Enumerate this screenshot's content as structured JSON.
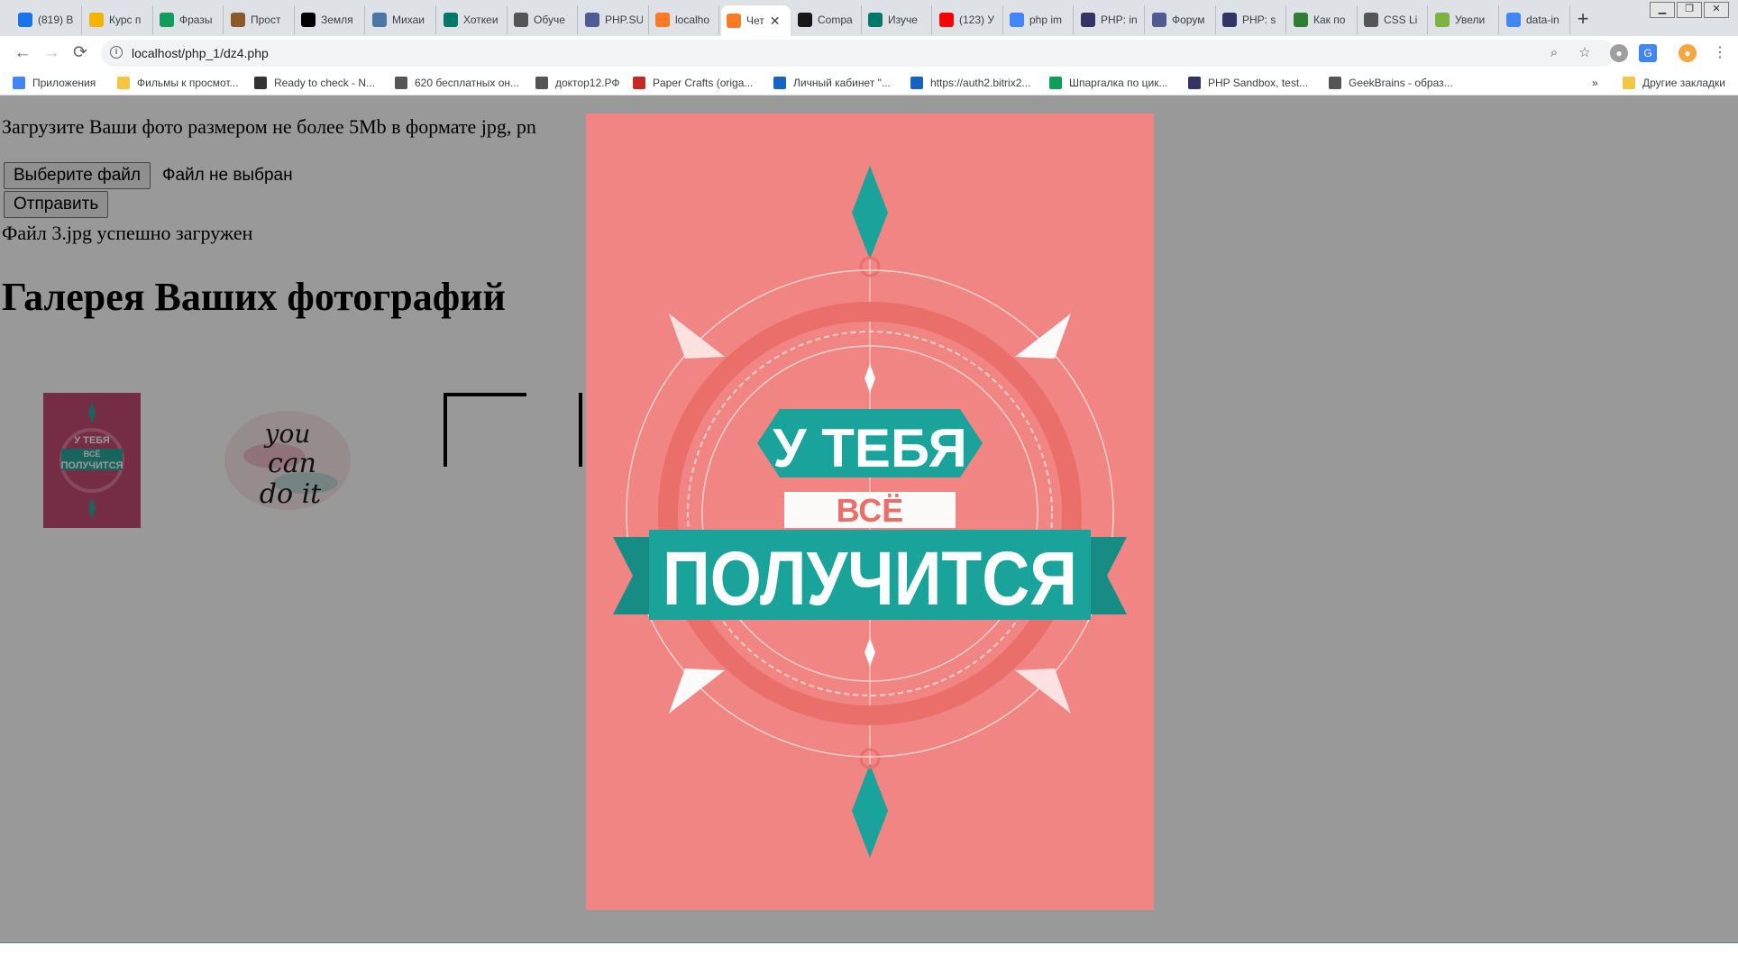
{
  "browser": {
    "tabs": [
      {
        "title": "(819) В",
        "icon": "mail-icon",
        "color": "#1a73e8"
      },
      {
        "title": "Курс п",
        "icon": "puzzle-icon",
        "color": "#f4b400"
      },
      {
        "title": "Фразы",
        "icon": "ed-icon",
        "color": "#0f9d58"
      },
      {
        "title": "Прост",
        "icon": "s-icon",
        "color": "#8b5a2b"
      },
      {
        "title": "Земля",
        "icon": "3g-icon",
        "color": "#000000"
      },
      {
        "title": "Михаи",
        "icon": "vk-icon",
        "color": "#4a76a8"
      },
      {
        "title": "Хоткеи",
        "icon": "circle-icon",
        "color": "#00796b"
      },
      {
        "title": "Обуче",
        "icon": "gear-icon",
        "color": "#555555"
      },
      {
        "title": "PHP.SU",
        "icon": "php-icon",
        "color": "#4f5b93"
      },
      {
        "title": "localho",
        "icon": "xampp-icon",
        "color": "#fb7a24"
      },
      {
        "title": "Чет",
        "icon": "xampp-icon",
        "color": "#fb7a24",
        "active": true
      },
      {
        "title": "Compa",
        "icon": "github-icon",
        "color": "#181717"
      },
      {
        "title": "Изуче",
        "icon": "circle-icon",
        "color": "#00796b"
      },
      {
        "title": "(123) У",
        "icon": "youtube-icon",
        "color": "#ff0000"
      },
      {
        "title": "php im",
        "icon": "google-icon",
        "color": "#4285f4"
      },
      {
        "title": "PHP: in",
        "icon": "php-doc-icon",
        "color": "#333366"
      },
      {
        "title": "Форум",
        "icon": "php-icon",
        "color": "#4f5b93"
      },
      {
        "title": "PHP: s",
        "icon": "php-doc-icon",
        "color": "#333366"
      },
      {
        "title": "Как по",
        "icon": "leaf-icon",
        "color": "#2e7d32"
      },
      {
        "title": "CSS Li",
        "icon": "globe-icon",
        "color": "#555555"
      },
      {
        "title": "Увели",
        "icon": "gear-green-icon",
        "color": "#7cb342"
      },
      {
        "title": "data-in",
        "icon": "google-icon",
        "color": "#4285f4"
      }
    ],
    "close_glyph": "✕",
    "new_tab_glyph": "+",
    "url": "localhost/php_1/dz4.php",
    "bookmarks": [
      {
        "label": "Приложения",
        "icon": "apps-icon",
        "color": "#4285f4"
      },
      {
        "label": "Фильмы к просмот...",
        "icon": "folder-icon",
        "color": "#f4c542"
      },
      {
        "label": "Ready to check - N...",
        "icon": "butterfly-icon",
        "color": "#333333"
      },
      {
        "label": "620 бесплатных он...",
        "icon": "globe-icon",
        "color": "#555555"
      },
      {
        "label": "доктор12.РФ",
        "icon": "doc-icon",
        "color": "#555555"
      },
      {
        "label": "Paper Crafts (origa...",
        "icon": "paper-icon",
        "color": "#c62828"
      },
      {
        "label": "Личный кабинет \"...",
        "icon": "pin-icon",
        "color": "#1565c0"
      },
      {
        "label": "https://auth2.bitrix2...",
        "icon": "bitrix-icon",
        "color": "#1565c0"
      },
      {
        "label": "Шпаргалка по цик...",
        "icon": "sheets-icon",
        "color": "#0f9d58"
      },
      {
        "label": "PHP Sandbox, test...",
        "icon": "sandbox-icon",
        "color": "#333366"
      },
      {
        "label": "GeekBrains - образ...",
        "icon": "gear-icon",
        "color": "#555555"
      }
    ],
    "bookmarks_overflow": "»",
    "other_bookmarks": "Другие закладки"
  },
  "page": {
    "intro": "Загрузите Ваши фото размером не более 5Mb в формате jpg, pn",
    "file_button": "Выберите файл",
    "file_status": "Файл не выбран",
    "submit_button": "Отправить",
    "upload_message": "Файл 3.jpg успешно загружен",
    "gallery_title": "Галерея Ваших фотографий"
  },
  "modal": {
    "poster_line1": "У ТЕБЯ",
    "poster_line2": "ВСЁ",
    "poster_line3": "ПОЛУЧИТСЯ",
    "poster_bg": "#f08583",
    "teal": "#1aa39a"
  },
  "thumbs": {
    "t1_line1": "У ТЕБЯ",
    "t1_line2": "ВСЁ",
    "t1_line3": "ПОЛУЧИТСЯ",
    "t2_line1": "you",
    "t2_line2": "can",
    "t2_line3": "do it"
  }
}
